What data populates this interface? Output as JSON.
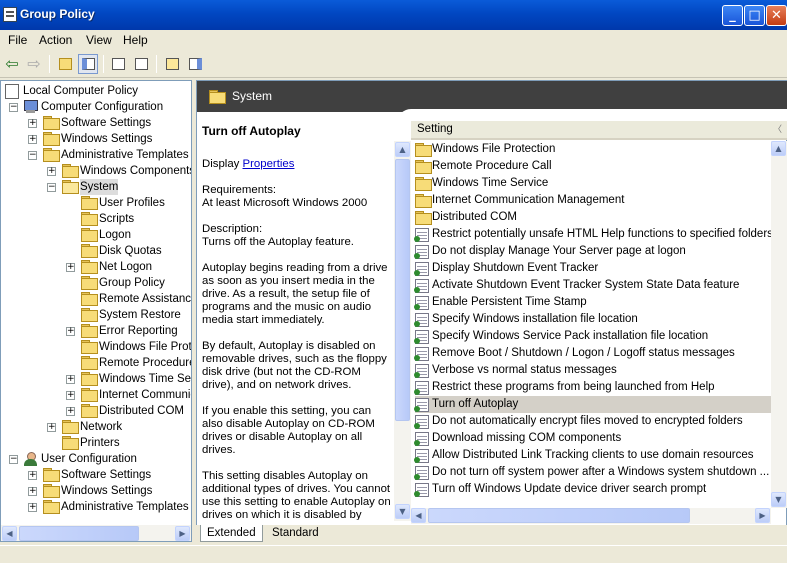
{
  "window": {
    "title": "Group Policy",
    "buttons": [
      "_",
      "□",
      "✕"
    ]
  },
  "menu": [
    "File",
    "Action",
    "View",
    "Help"
  ],
  "toolbar": {
    "icons": [
      "back-icon",
      "forward-icon",
      "up-folder-icon",
      "show-hide-tree-icon",
      "properties-icon",
      "export-list-icon",
      "help-icon",
      "show-hide-action-pane-icon"
    ]
  },
  "tree": [
    {
      "label": "Local Computer Policy",
      "icon": "doc"
    },
    {
      "label": "Computer Configuration",
      "icon": "pc"
    },
    {
      "label": "Software Settings",
      "icon": "folder"
    },
    {
      "label": "Windows Settings",
      "icon": "folder"
    },
    {
      "label": "Administrative Templates",
      "icon": "folder"
    },
    {
      "label": "Windows Components",
      "icon": "folder"
    },
    {
      "label": "System",
      "icon": "folder-open"
    },
    {
      "label": "User Profiles",
      "icon": "folder"
    },
    {
      "label": "Scripts",
      "icon": "folder"
    },
    {
      "label": "Logon",
      "icon": "folder"
    },
    {
      "label": "Disk Quotas",
      "icon": "folder"
    },
    {
      "label": "Net Logon",
      "icon": "folder"
    },
    {
      "label": "Group Policy",
      "icon": "folder"
    },
    {
      "label": "Remote Assistance",
      "icon": "folder"
    },
    {
      "label": "System Restore",
      "icon": "folder"
    },
    {
      "label": "Error Reporting",
      "icon": "folder"
    },
    {
      "label": "Windows File Prote",
      "icon": "folder"
    },
    {
      "label": "Remote Procedure",
      "icon": "folder"
    },
    {
      "label": "Windows Time Serv",
      "icon": "folder"
    },
    {
      "label": "Internet Communic",
      "icon": "folder"
    },
    {
      "label": "Distributed COM",
      "icon": "folder"
    },
    {
      "label": "Network",
      "icon": "folder"
    },
    {
      "label": "Printers",
      "icon": "folder"
    },
    {
      "label": "User Configuration",
      "icon": "user"
    },
    {
      "label": "Software Settings",
      "icon": "folder"
    },
    {
      "label": "Windows Settings",
      "icon": "folder"
    },
    {
      "label": "Administrative Templates",
      "icon": "folder"
    }
  ],
  "header": {
    "title": "System"
  },
  "description": {
    "title": "Turn off Autoplay",
    "display_prefix": "Display",
    "properties_link": "Properties",
    "requirements_label": "Requirements:",
    "requirements_value": "At least Microsoft Windows 2000",
    "description_label": "Description:",
    "description_value": "Turns off the Autoplay feature.",
    "para1": "Autoplay begins reading from a drive as soon as you insert media in the drive. As a result, the setup file of programs and the music on audio media start immediately.",
    "para2": "By default, Autoplay is disabled on removable drives, such as the floppy disk drive (but not the CD-ROM drive), and on network drives.",
    "para3": "If you enable this setting, you can also disable Autoplay on CD-ROM drives or disable Autoplay on all drives.",
    "para4": "This setting disables Autoplay on additional types of drives. You cannot use this setting to enable Autoplay on drives on which it is disabled by default."
  },
  "list": {
    "column_header": "Setting",
    "items": [
      {
        "label": "Windows File Protection",
        "icon": "folder"
      },
      {
        "label": "Remote Procedure Call",
        "icon": "folder"
      },
      {
        "label": "Windows Time Service",
        "icon": "folder"
      },
      {
        "label": "Internet Communication Management",
        "icon": "folder"
      },
      {
        "label": "Distributed COM",
        "icon": "folder"
      },
      {
        "label": "Restrict potentially unsafe HTML Help functions to specified folders",
        "icon": "policy"
      },
      {
        "label": "Do not display Manage Your Server page at logon",
        "icon": "policy"
      },
      {
        "label": "Display Shutdown Event Tracker",
        "icon": "policy"
      },
      {
        "label": "Activate Shutdown Event Tracker System State Data feature",
        "icon": "policy"
      },
      {
        "label": "Enable Persistent Time Stamp",
        "icon": "policy"
      },
      {
        "label": "Specify Windows installation file location",
        "icon": "policy"
      },
      {
        "label": "Specify Windows Service Pack installation file location",
        "icon": "policy"
      },
      {
        "label": "Remove Boot / Shutdown / Logon / Logoff status messages",
        "icon": "policy"
      },
      {
        "label": "Verbose vs normal status messages",
        "icon": "policy"
      },
      {
        "label": "Restrict these programs from being launched from Help",
        "icon": "policy"
      },
      {
        "label": "Turn off Autoplay",
        "icon": "policy",
        "selected": true
      },
      {
        "label": "Do not automatically encrypt files moved to encrypted folders",
        "icon": "policy"
      },
      {
        "label": "Download missing COM components",
        "icon": "policy"
      },
      {
        "label": "Allow Distributed Link Tracking clients to use domain resources",
        "icon": "policy"
      },
      {
        "label": "Do not turn off system power after a Windows system shutdown ...",
        "icon": "policy"
      },
      {
        "label": "Turn off Windows Update device driver search prompt",
        "icon": "policy"
      }
    ]
  },
  "tabs": [
    "Extended",
    "Standard"
  ]
}
